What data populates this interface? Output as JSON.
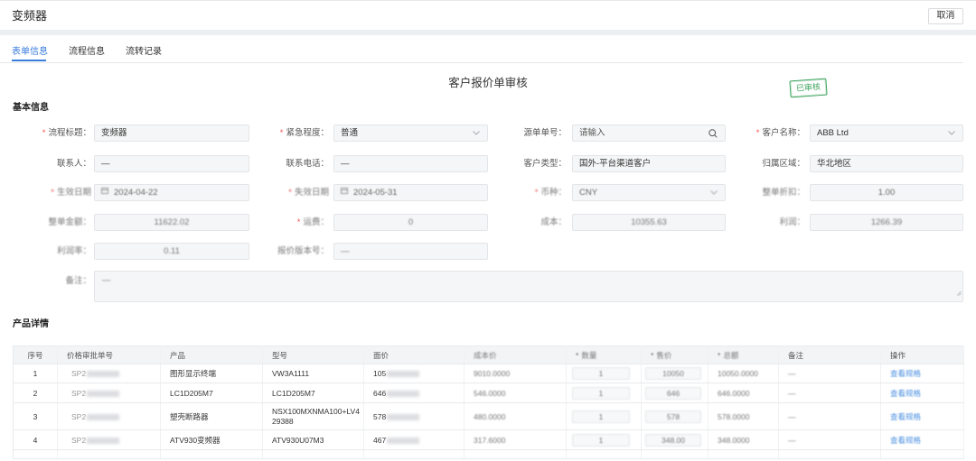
{
  "header": {
    "title": "变频器",
    "cancel_label": "取消"
  },
  "tabs": [
    {
      "label": "表单信息",
      "active": true
    },
    {
      "label": "流程信息",
      "active": false
    },
    {
      "label": "流转记录",
      "active": false
    }
  ],
  "form_title": "客户报价单审核",
  "stamp": "已审核",
  "required_mark": "*",
  "colors": {
    "accent": "#3b7ddd",
    "stamp": "#3da35d",
    "required": "#f05454",
    "link": "#4a8fe0"
  },
  "basic_info": {
    "section_title": "基本信息",
    "fields": [
      {
        "label": "流程标题：",
        "required": true,
        "value": "变频器"
      },
      {
        "label": "紧急程度：",
        "required": true,
        "value": "普通",
        "icon": "chevron-down-icon"
      },
      {
        "label": "源单单号：",
        "required": false,
        "placeholder": "请输入",
        "icon": "search-icon"
      },
      {
        "label": "客户名称：",
        "required": true,
        "value": "ABB Ltd",
        "icon": "chevron-down-icon"
      },
      {
        "label": "联系人：",
        "required": false,
        "value": "—"
      },
      {
        "label": "联系电话：",
        "required": false,
        "value": "—"
      },
      {
        "label": "客户类型：",
        "required": false,
        "value": "国外-平台渠道客户"
      },
      {
        "label": "归属区域：",
        "required": false,
        "value": "华北地区"
      },
      {
        "label": "生效日期",
        "required": true,
        "value": "2024-04-22",
        "icon": "calendar-icon"
      },
      {
        "label": "失效日期",
        "required": true,
        "value": "2024-05-31",
        "icon": "calendar-icon"
      },
      {
        "label": "币种：",
        "required": true,
        "value": "CNY",
        "icon": "chevron-down-icon"
      },
      {
        "label": "整单折扣：",
        "required": false,
        "value": "1.00"
      },
      {
        "label": "整单金额：",
        "required": false,
        "value": "11622.02"
      },
      {
        "label": "运费：",
        "required": true,
        "value": "0"
      },
      {
        "label": "成本：",
        "required": false,
        "value": "10355.63"
      },
      {
        "label": "利润：",
        "required": false,
        "value": "1266.39"
      },
      {
        "label": "利润率：",
        "required": false,
        "value": "0.11"
      },
      {
        "label": "报价版本号：",
        "required": false,
        "value": "—"
      },
      {
        "label": "备注：",
        "required": false,
        "value": "—"
      }
    ]
  },
  "product_table": {
    "section_title": "产品详情",
    "headers": [
      {
        "label": "序号",
        "required": false
      },
      {
        "label": "价格审批单号",
        "required": false
      },
      {
        "label": "产品",
        "required": false
      },
      {
        "label": "型号",
        "required": false
      },
      {
        "label": "面价",
        "required": false
      },
      {
        "label": "成本价",
        "required": false
      },
      {
        "label": "数量",
        "required": true
      },
      {
        "label": "售价",
        "required": true
      },
      {
        "label": "总额",
        "required": true
      },
      {
        "label": "备注",
        "required": false
      },
      {
        "label": "操作",
        "required": false
      }
    ],
    "rows": [
      {
        "no": "1",
        "approval_no_prefix": "SP2",
        "product": "图形显示终端",
        "model": "VW3A1111",
        "face_price_prefix": "105",
        "cost_price": "9010.0000",
        "qty": "1",
        "unit_price": "10050",
        "total": "10050.0000",
        "remark": "—",
        "action": "查看规格"
      },
      {
        "no": "2",
        "approval_no_prefix": "SP2",
        "product": "LC1D205M7",
        "model": "LC1D205M7",
        "face_price_prefix": "646",
        "cost_price": "546.0000",
        "qty": "1",
        "unit_price": "646",
        "total": "646.0000",
        "remark": "—",
        "action": "查看规格"
      },
      {
        "no": "3",
        "approval_no_prefix": "SP2",
        "product": "塑壳断路器",
        "model": "NSX100MXNMA100+LV429388",
        "face_price_prefix": "578",
        "cost_price": "480.0000",
        "qty": "1",
        "unit_price": "578",
        "total": "578.0000",
        "remark": "—",
        "action": "查看规格"
      },
      {
        "no": "4",
        "approval_no_prefix": "SP2",
        "product": "ATV930变频器",
        "model": "ATV930U07M3",
        "face_price_prefix": "467",
        "cost_price": "317.6000",
        "qty": "1",
        "unit_price": "348.00",
        "total": "348.0000",
        "remark": "—",
        "action": "查看规格"
      }
    ]
  }
}
